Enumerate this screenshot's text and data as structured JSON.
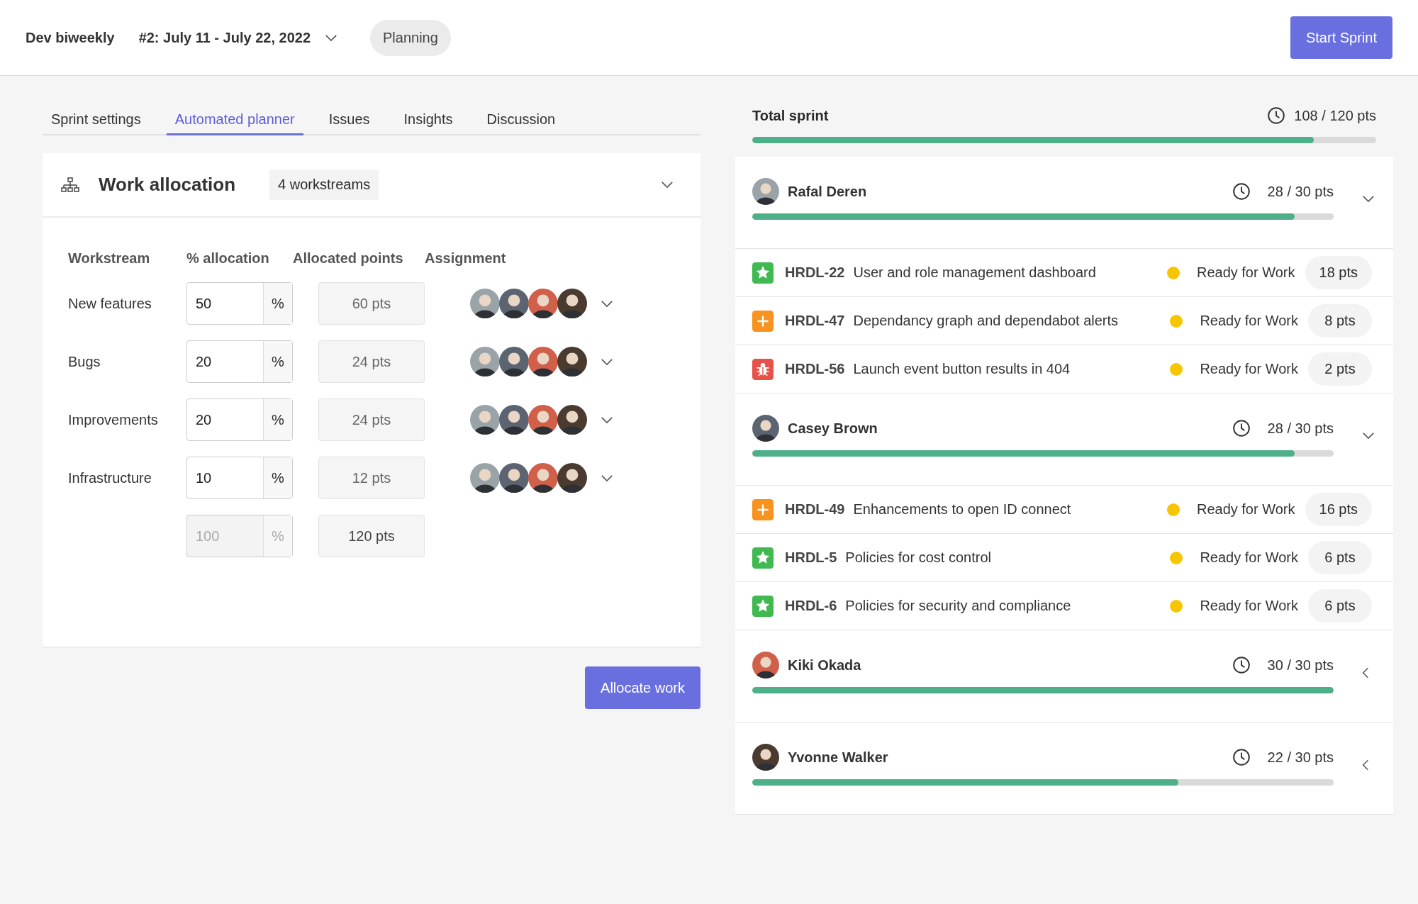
{
  "header": {
    "team": "Dev biweekly",
    "sprint": "#2: July 11 - July 22, 2022",
    "status": "Planning",
    "action": "Start Sprint"
  },
  "tabs": [
    {
      "label": "Sprint settings",
      "selected": false
    },
    {
      "label": "Automated planner",
      "selected": true
    },
    {
      "label": "Issues",
      "selected": false
    },
    {
      "label": "Insights",
      "selected": false
    },
    {
      "label": "Discussion",
      "selected": false
    }
  ],
  "work_allocation": {
    "title": "Work allocation",
    "badge": "4 workstreams",
    "expanded": true,
    "columns": [
      "Workstream",
      "% allocation",
      "Allocated points",
      "Assignment"
    ],
    "rows": [
      {
        "name": "New features",
        "value": "50",
        "unit": "%",
        "points": "60 pts"
      },
      {
        "name": "Bugs",
        "value": "20",
        "unit": "%",
        "points": "24 pts"
      },
      {
        "name": "Improvements",
        "value": "20",
        "unit": "%",
        "points": "24 pts"
      },
      {
        "name": "Infrastructure",
        "value": "10",
        "unit": "%",
        "points": "12 pts"
      }
    ],
    "total": {
      "value": "100",
      "unit": "%",
      "points": "120 pts",
      "disabled": true
    },
    "action": "Allocate work"
  },
  "total_sprint": {
    "label": "Total sprint",
    "points": "108 / 120 pts",
    "level": 0.9
  },
  "members": [
    {
      "name": "Rafal Deren",
      "points": "28 / 30 pts",
      "level": 0.933,
      "expanded": true,
      "issues": [
        {
          "kind": "story",
          "key": "HRDL-22",
          "title": "User and role management dashboard",
          "status": "Ready for Work",
          "points": "18 pts"
        },
        {
          "kind": "improvement",
          "key": "HRDL-47",
          "title": "Dependancy graph and dependabot alerts",
          "status": "Ready for Work",
          "points": "8 pts"
        },
        {
          "kind": "bug",
          "key": "HRDL-56",
          "title": "Launch event button results in 404",
          "status": "Ready for Work",
          "points": "2 pts"
        }
      ]
    },
    {
      "name": "Casey Brown",
      "points": "28 / 30 pts",
      "level": 0.933,
      "expanded": true,
      "issues": [
        {
          "kind": "improvement",
          "key": "HRDL-49",
          "title": "Enhancements to open ID connect",
          "status": "Ready for Work",
          "points": "16 pts"
        },
        {
          "kind": "story",
          "key": "HRDL-5",
          "title": "Policies for cost control",
          "status": "Ready for Work",
          "points": "6 pts"
        },
        {
          "kind": "story",
          "key": "HRDL-6",
          "title": "Policies for security and compliance",
          "status": "Ready for Work",
          "points": "6 pts"
        }
      ]
    },
    {
      "name": "Kiki Okada",
      "points": "30 / 30 pts",
      "level": 1,
      "expanded": false
    },
    {
      "name": "Yvonne Walker",
      "points": "22 / 30 pts",
      "level": 0.733,
      "expanded": false
    }
  ]
}
